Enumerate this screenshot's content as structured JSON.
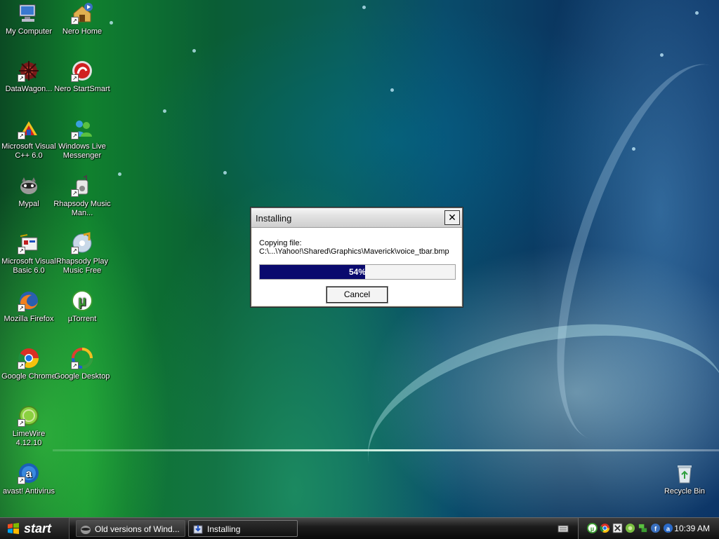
{
  "desktop": {
    "icons": [
      {
        "label": "My Computer"
      },
      {
        "label": "Nero Home"
      },
      {
        "label": "DataWagon..."
      },
      {
        "label": "Nero StartSmart"
      },
      {
        "label": "Microsoft Visual C++ 6.0"
      },
      {
        "label": "Windows Live Messenger"
      },
      {
        "label": "Mypal"
      },
      {
        "label": "Rhapsody Music Man..."
      },
      {
        "label": "Microsoft Visual Basic 6.0"
      },
      {
        "label": "Rhapsody Play Music Free"
      },
      {
        "label": "Mozilla Firefox"
      },
      {
        "label": "µTorrent"
      },
      {
        "label": "Google Chrome"
      },
      {
        "label": "Google Desktop"
      },
      {
        "label": "LimeWire 4.12.10"
      },
      {
        "label": "avast! Antivirus"
      },
      {
        "label": "Recycle Bin"
      }
    ]
  },
  "dialog": {
    "title": "Installing",
    "close_glyph": "✕",
    "copying_label": "Copying file:",
    "file_path": "C:\\...\\Yahoo!\\Shared\\Graphics\\Maverick\\voice_tbar.bmp",
    "progress_percent": 54,
    "progress_text": "54%",
    "cancel_label": "Cancel"
  },
  "taskbar": {
    "start_label": "start",
    "tasks": [
      {
        "label": "Old versions of Wind..."
      },
      {
        "label": "Installing"
      }
    ],
    "clock": "10:39 AM",
    "tray_icons": [
      "utorrent-icon",
      "chrome-icon",
      "close-box-icon",
      "green-app-icon",
      "network-icon",
      "info-icon",
      "avast-icon"
    ]
  },
  "colors": {
    "progress_fill": "#0a0a6e",
    "taskbar": "#1c1c1c"
  }
}
